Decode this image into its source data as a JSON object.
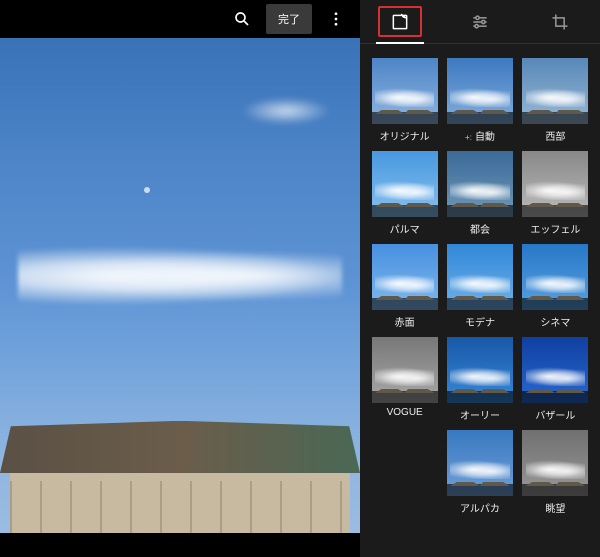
{
  "toolbar": {
    "done_label": "完了"
  },
  "tabs": {
    "active": "filters"
  },
  "filters": [
    {
      "id": "original",
      "label": "オリジナル",
      "cls": "f-orig"
    },
    {
      "id": "auto",
      "label": "自動",
      "cls": "f-auto",
      "badge": "+:"
    },
    {
      "id": "west",
      "label": "西部",
      "cls": "f-west"
    },
    {
      "id": "palma",
      "label": "パルマ",
      "cls": "f-palma"
    },
    {
      "id": "metro",
      "label": "都会",
      "cls": "f-metro"
    },
    {
      "id": "eiffel",
      "label": "エッフェル",
      "cls": "f-eiffel"
    },
    {
      "id": "blush",
      "label": "赤面",
      "cls": "f-blush"
    },
    {
      "id": "modena",
      "label": "モデナ",
      "cls": "f-modena"
    },
    {
      "id": "cinema",
      "label": "シネマ",
      "cls": "f-cinema"
    },
    {
      "id": "vogue",
      "label": "VOGUE",
      "cls": "f-vogue"
    },
    {
      "id": "ollie",
      "label": "オーリー",
      "cls": "f-ollie"
    },
    {
      "id": "bazaar",
      "label": "バザール",
      "cls": "f-bazaar"
    },
    {
      "id": "alpaca",
      "label": "アルパカ",
      "cls": "f-alpaca"
    },
    {
      "id": "vista",
      "label": "眺望",
      "cls": "f-vista"
    }
  ]
}
